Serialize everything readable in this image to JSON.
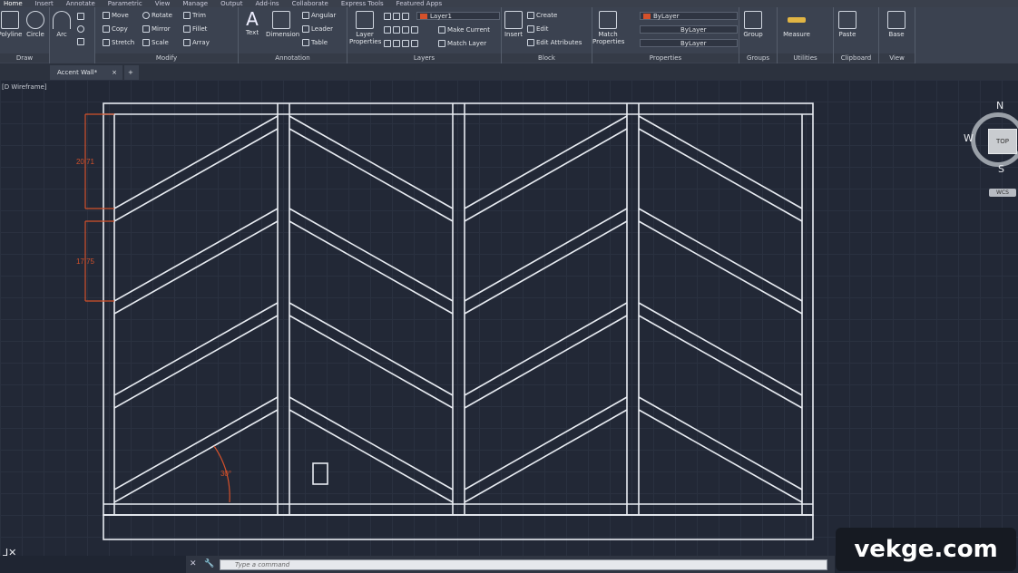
{
  "menu": [
    "Home",
    "Insert",
    "Annotate",
    "Parametric",
    "View",
    "Manage",
    "Output",
    "Add-ins",
    "Collaborate",
    "Express Tools",
    "Featured Apps"
  ],
  "panels": {
    "draw": {
      "title": "Draw",
      "tools": [
        "Polyline",
        "Circle",
        "Arc"
      ]
    },
    "modify": {
      "title": "Modify",
      "tools": [
        "Move",
        "Rotate",
        "Trim",
        "Copy",
        "Mirror",
        "Fillet",
        "Stretch",
        "Scale",
        "Array"
      ]
    },
    "annotation": {
      "title": "Annotation",
      "tools": [
        "Text",
        "Dimension",
        "Angular",
        "Leader",
        "Table"
      ]
    },
    "layers": {
      "title": "Layers",
      "layer_props": "Layer Properties",
      "current_layer": "Layer1",
      "make_current": "Make Current",
      "match_layer": "Match Layer"
    },
    "block": {
      "title": "Block",
      "insert": "Insert",
      "create": "Create",
      "edit": "Edit",
      "edit_attributes": "Edit Attributes"
    },
    "properties": {
      "title": "Properties",
      "match": "Match Properties",
      "color": "ByLayer",
      "linetype": "ByLayer",
      "lineweight": "ByLayer"
    },
    "groups": {
      "title": "Groups",
      "group": "Group"
    },
    "utilities": {
      "title": "Utilities",
      "measure": "Measure"
    },
    "clipboard": {
      "title": "Clipboard",
      "paste": "Paste"
    },
    "view": {
      "title": "View",
      "base": "Base"
    }
  },
  "tabs": {
    "document": "Accent Wall*",
    "close": "×",
    "new": "+"
  },
  "viewport": {
    "label": "[D Wireframe]"
  },
  "dimensions": [
    {
      "value": "20.71",
      "name": "dim-upper"
    },
    {
      "value": "17.75",
      "name": "dim-lower"
    },
    {
      "value": "30°",
      "name": "dim-angle"
    }
  ],
  "viewcube": {
    "north": "N",
    "south": "S",
    "west": "W",
    "face": "TOP",
    "wcs": "WCS"
  },
  "command": {
    "placeholder": "Type a command"
  },
  "watermark": "vekge.com",
  "colors": {
    "background": "#222836",
    "lines": "#e8ecf2",
    "dimension": "#d4512b",
    "ribbon": "#3b4250"
  }
}
